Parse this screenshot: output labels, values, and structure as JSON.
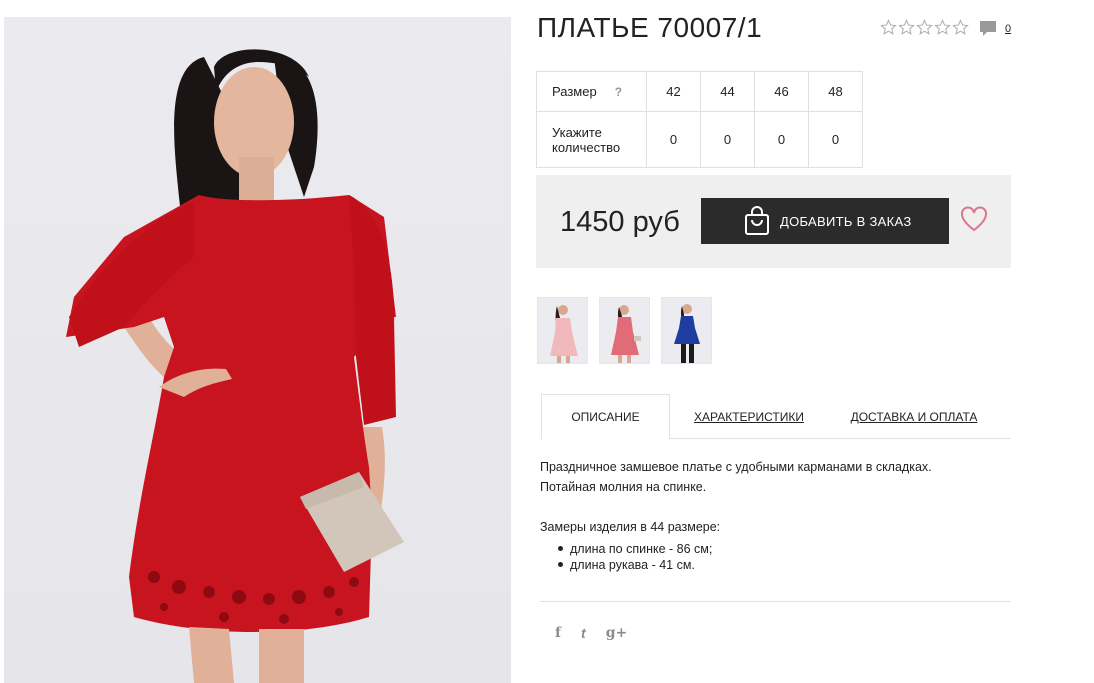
{
  "product": {
    "title": "ПЛАТЬЕ 70007/1",
    "rating_stars": 0,
    "rating_max": 5,
    "comment_count": "0"
  },
  "sizes": {
    "size_label": "Размер",
    "help_icon": "?",
    "qty_label": "Укажите количество",
    "values": [
      "42",
      "44",
      "46",
      "48"
    ],
    "quantities": [
      "0",
      "0",
      "0",
      "0"
    ]
  },
  "purchase": {
    "price": "1450 руб",
    "add_button": "ДОБАВИТЬ В ЗАКАЗ"
  },
  "tabs": {
    "description": "ОПИСАНИЕ",
    "characteristics": "ХАРАКТЕРИСТИКИ",
    "delivery": "ДОСТАВКА И ОПЛАТА"
  },
  "description": {
    "line1": "Праздничное замшевое платье с удобными карманами в складках.",
    "line2": "Потайная молния на спинке.",
    "measures_title": "Замеры изделия в 44 размере:",
    "measures": [
      "длина по спинке - 86 см;",
      "длина рукава - 41 см."
    ]
  },
  "social": {
    "facebook": "f",
    "twitter": "t",
    "google": "g+"
  },
  "icons": {
    "stars": "star-outline-icon",
    "comments": "comment-icon",
    "bag": "shopping-bag-icon",
    "wishlist": "heart-icon"
  },
  "colors": {
    "dress_red": "#c8141e",
    "button_dark": "#2b2b2b",
    "heart_pink": "#d9788a",
    "price_bg": "#efefef"
  }
}
